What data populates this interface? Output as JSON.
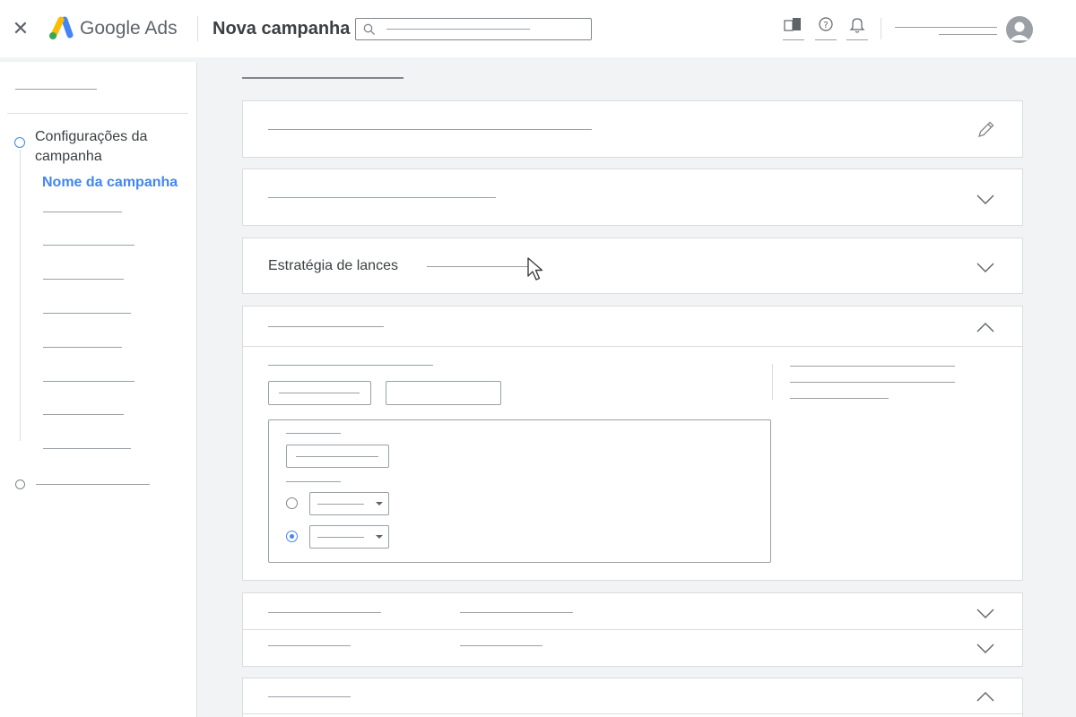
{
  "header": {
    "close_icon": "close-icon",
    "brand": "Google Ads",
    "title": "Nova campanha",
    "search_placeholder": "",
    "icons": [
      "reports-icon",
      "help-icon",
      "notifications-icon"
    ]
  },
  "sidebar": {
    "steps": [
      {
        "label": "Configurações da campanha",
        "active": true
      },
      {
        "label": ""
      }
    ],
    "active_subitem": "Nome da campanha",
    "colors": {
      "active": "#4285f4",
      "text": "#3c4043"
    }
  },
  "main": {
    "sections": [
      {
        "label": "",
        "control": "edit-icon"
      },
      {
        "label": "",
        "control": "expand"
      },
      {
        "label": "Estratégia de lances",
        "control": "expand"
      },
      {
        "label": "",
        "control": "collapse",
        "expanded": true
      },
      {
        "label": "",
        "control": "expand"
      },
      {
        "label": "",
        "control": "expand"
      },
      {
        "label": "",
        "control": "collapse"
      }
    ],
    "radio_options": [
      {
        "selected": false
      },
      {
        "selected": true
      }
    ]
  }
}
